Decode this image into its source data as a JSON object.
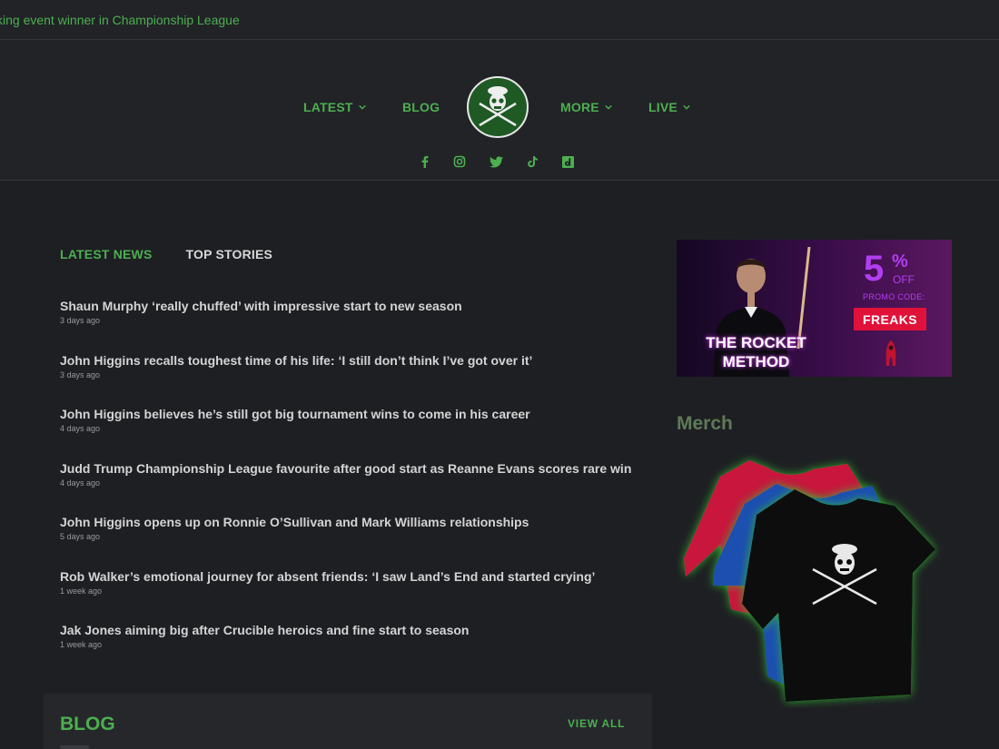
{
  "ticker": {
    "text": "king event winner in Championship League"
  },
  "nav": {
    "latest": "LATEST",
    "blog": "BLOG",
    "more": "MORE",
    "live": "LIVE"
  },
  "socials": [
    "facebook-icon",
    "instagram-icon",
    "twitter-icon",
    "tiktok-icon",
    "dailymotion-icon"
  ],
  "tabs": {
    "latest_news": "LATEST NEWS",
    "top_stories": "TOP STORIES"
  },
  "news": [
    {
      "title": "Shaun Murphy ‘really chuffed’ with impressive start to new season",
      "time": "3 days ago"
    },
    {
      "title": "John Higgins recalls toughest time of his life: ‘I still don’t think I’ve got over it’",
      "time": "3 days ago"
    },
    {
      "title": "John Higgins believes he’s still got big tournament wins to come in his career",
      "time": "4 days ago"
    },
    {
      "title": "Judd Trump Championship League favourite after good start as Reanne Evans scores rare win",
      "time": "4 days ago"
    },
    {
      "title": "John Higgins opens up on Ronnie O’Sullivan and Mark Williams relationships",
      "time": "5 days ago"
    },
    {
      "title": "Rob Walker’s emotional journey for absent friends: ‘I saw Land’s End and started crying’",
      "time": "1 week ago"
    },
    {
      "title": "Jak Jones aiming big after Crucible heroics and fine start to season",
      "time": "1 week ago"
    }
  ],
  "blog": {
    "title": "BLOG",
    "view_all": "VIEW ALL"
  },
  "ad": {
    "headline": "THE ROCKET METHOD",
    "percent": "5",
    "percent_sign": "%",
    "off": "OFF",
    "promo_label": "PROMO CODE:",
    "promo_code": "FREAKS"
  },
  "merch": {
    "title": "Merch"
  },
  "colors": {
    "accent": "#4caf50",
    "background": "#1e1f23",
    "header": "#222327",
    "promo_purple": "#b13ef0",
    "promo_red": "#e0123a"
  }
}
